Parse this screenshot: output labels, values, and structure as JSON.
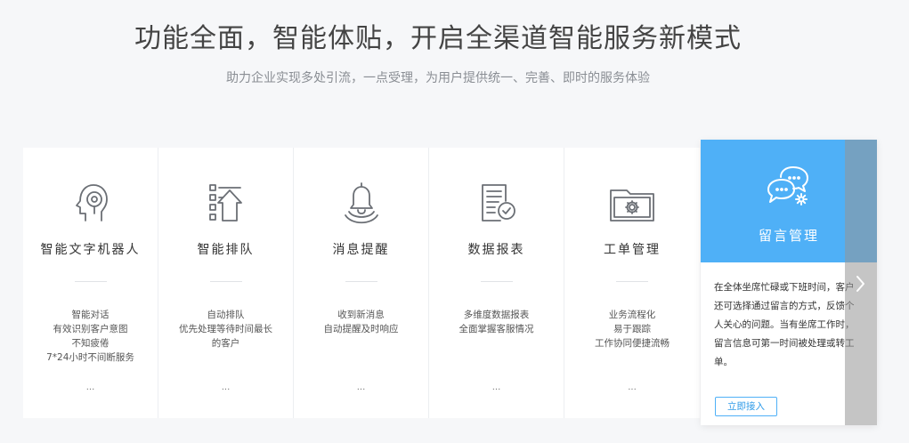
{
  "header": {
    "title": "功能全面，智能体贴，开启全渠道智能服务新模式",
    "subtitle": "助力企业实现多处引流，一点受理，为用户提供统一、完善、即时的服务体验"
  },
  "cards": [
    {
      "icon": "robot-head-icon",
      "name": "智能文字机器人",
      "lines": [
        "智能对话",
        "有效识别客户意图",
        "不知疲倦",
        "7*24小时不间断服务"
      ],
      "more": "..."
    },
    {
      "icon": "queue-icon",
      "name": "智能排队",
      "lines": [
        "自动排队",
        "优先处理等待时间最长",
        "的客户"
      ],
      "more": "..."
    },
    {
      "icon": "bell-icon",
      "name": "消息提醒",
      "lines": [
        "收到新消息",
        "自动提醒及时响应"
      ],
      "more": "..."
    },
    {
      "icon": "report-icon",
      "name": "数据报表",
      "lines": [
        "多维度数据报表",
        "全面掌握客服情况"
      ],
      "more": "..."
    },
    {
      "icon": "folder-gear-icon",
      "name": "工单管理",
      "lines": [
        "业务流程化",
        "易于跟踪",
        "工作协同便捷流畅"
      ],
      "more": "..."
    }
  ],
  "feature": {
    "icon": "chat-gear-icon",
    "name": "留言管理",
    "text": "在全体坐席忙碌或下班时间，客户还可选择通过留言的方式，反馈个人关心的问题。当有坐席工作时，留言信息可第一时间被处理或转工单。",
    "cta": "立即接入"
  },
  "nav": {
    "next_icon": "chevron-right-icon"
  },
  "colors": {
    "accent": "#4fb0f7",
    "page_bg": "#f6f7f9",
    "icon_stroke": "#6b6f75"
  }
}
